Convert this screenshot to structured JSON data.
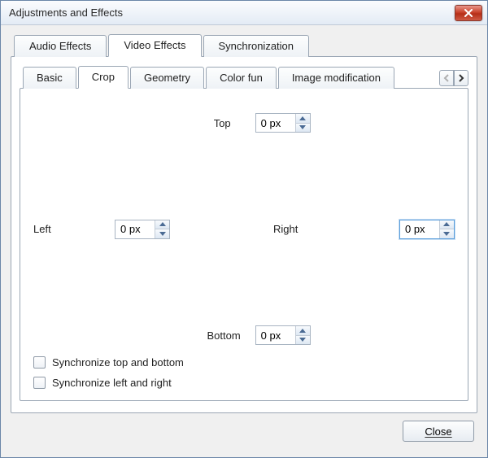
{
  "window": {
    "title": "Adjustments and Effects"
  },
  "mainTabs": {
    "audio": "Audio Effects",
    "video": "Video Effects",
    "sync": "Synchronization",
    "active": "video"
  },
  "subTabs": {
    "basic": "Basic",
    "crop": "Crop",
    "geometry": "Geometry",
    "colorfun": "Color fun",
    "imagemod": "Image modification",
    "active": "crop"
  },
  "crop": {
    "top": {
      "label": "Top",
      "value": "0 px"
    },
    "left": {
      "label": "Left",
      "value": "0 px"
    },
    "right": {
      "label": "Right",
      "value": "0 px"
    },
    "bottom": {
      "label": "Bottom",
      "value": "0 px"
    },
    "syncTB": {
      "label": "Synchronize top and bottom",
      "checked": false
    },
    "syncLR": {
      "label": "Synchronize left and right",
      "checked": false
    }
  },
  "footer": {
    "close": "Close"
  },
  "colors": {
    "accent": "#5a9ddb"
  }
}
